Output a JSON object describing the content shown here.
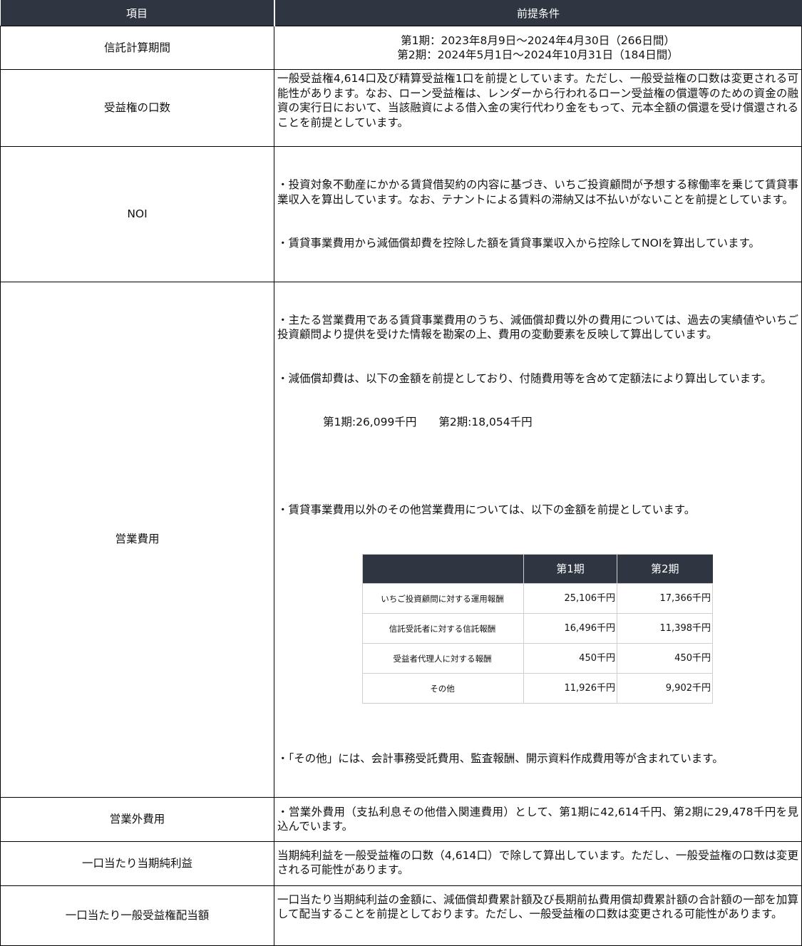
{
  "header": {
    "col1": "項目",
    "col2": "前提条件"
  },
  "rows": [
    {
      "label": "信託計算期間",
      "lines": [
        "第1期：2023年8月9日～2024年4月30日（266日間）",
        "第2期：2024年5月1日～2024年10月31日（184日間）"
      ]
    },
    {
      "label": "受益権の口数",
      "text": "一般受益権4,614口及び精算受益権1口を前提としています。ただし、一般受益権の口数は変更される可能性があります。なお、ローン受益権は、レンダーから行われるローン受益権の償還等のための資金の融資の実行日において、当該融資による借入金の実行代わり金をもって、元本全額の償還を受け償還されることを前提としています。"
    },
    {
      "label": "NOI",
      "p1": "・投資対象不動産にかかる賃貸借契約の内容に基づき、いちご投資顧問が予想する稼働率を乗じて賃貸事業収入を算出しています。なお、テナントによる賃料の滞納又は不払いがないことを前提としています。",
      "p2": "・賃貸事業費用から減価償却費を控除した額を賃貸事業収入から控除してNOIを算出しています。"
    },
    {
      "label": "営業費用",
      "p1": "・主たる営業費用である賃貸事業費用のうち、減価償却費以外の費用については、過去の実績値やいちご投資顧問より提供を受けた情報を勘案の上、費用の変動要素を反映して算出しています。",
      "p2": "・減価償却費は、以下の金額を前提としており、付随費用等を含めて定額法により算出しています。",
      "amounts": "第1期:26,099千円　　第2期:18,054千円",
      "p3": "・賃貸事業費用以外のその他営業費用については、以下の金額を前提としています。",
      "table": {
        "headers": [
          "",
          "第1期",
          "第2期"
        ],
        "rows": [
          {
            "name": "いちご投資顧問に対する運用報酬",
            "p1": "25,106千円",
            "p2": "17,366千円"
          },
          {
            "name": "信託受託者に対する信託報酬",
            "p1": "16,496千円",
            "p2": "11,398千円"
          },
          {
            "name": "受益者代理人に対する報酬",
            "p1": "450千円",
            "p2": "450千円"
          },
          {
            "name": "その他",
            "p1": "11,926千円",
            "p2": "9,902千円"
          }
        ]
      },
      "p4": "・「その他」には、会計事務受託費用、監査報酬、開示資料作成費用等が含まれています。"
    },
    {
      "label": "営業外費用",
      "text": "・営業外費用（支払利息その他借入関連費用）として、第1期に42,614千円、第2期に29,478千円を見込んでいます。"
    },
    {
      "label": "一口当たり当期純利益",
      "text": "当期純利益を一般受益権の口数（4,614口）で除して算出しています。ただし、一般受益権の口数は変更される可能性があります。"
    },
    {
      "label": "一口当たり一般受益権配当額",
      "text": "一口当たり当期純利益の金額に、減価償却費累計額及び長期前払費用償却費累計額の合計額の一部を加算して配当することを前提としております。ただし、一般受益権の口数は変更される可能性があります。"
    }
  ]
}
